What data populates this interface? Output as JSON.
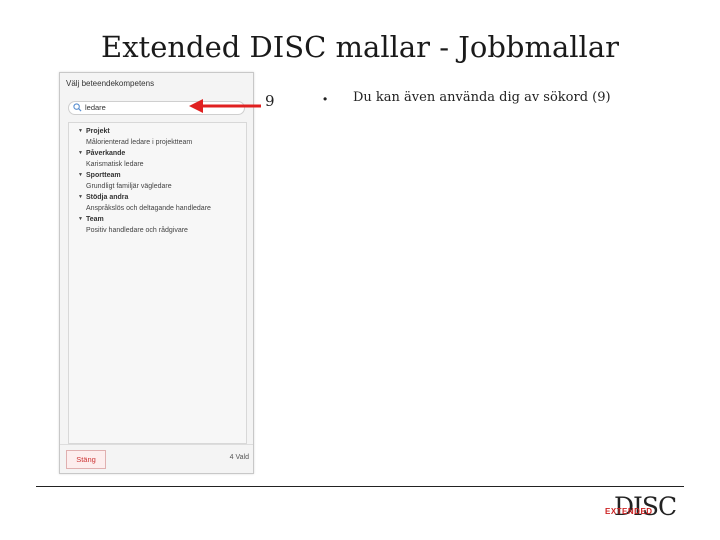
{
  "slide": {
    "title": "Extended DISC mallar - Jobbmallar"
  },
  "panel": {
    "header": "Välj beteendekompetens",
    "search": {
      "value": "ledare"
    },
    "groups": [
      {
        "name": "Projekt",
        "items": [
          "Målorienterad ledare i projektteam"
        ]
      },
      {
        "name": "Påverkande",
        "items": [
          "Karismatisk ledare"
        ]
      },
      {
        "name": "Sportteam",
        "items": [
          "Grundligt familjär vägledare"
        ]
      },
      {
        "name": "Stödja andra",
        "items": [
          "Anspråkslös och deltagande handledare"
        ]
      },
      {
        "name": "Team",
        "items": [
          "Positiv handledare och rådgivare"
        ]
      }
    ],
    "footer": {
      "close_label": "Stäng",
      "selected": "4 Vald"
    }
  },
  "callout": {
    "number": "9"
  },
  "bullets": [
    {
      "marker": "•",
      "text": "Du kan även använda dig av sökord (9)"
    }
  ],
  "logo": {
    "disc": "DISC",
    "extended": "EXTENDED"
  },
  "colors": {
    "arrow": "#e02020",
    "close_text": "#cc3333",
    "logo_red": "#cc2222"
  }
}
